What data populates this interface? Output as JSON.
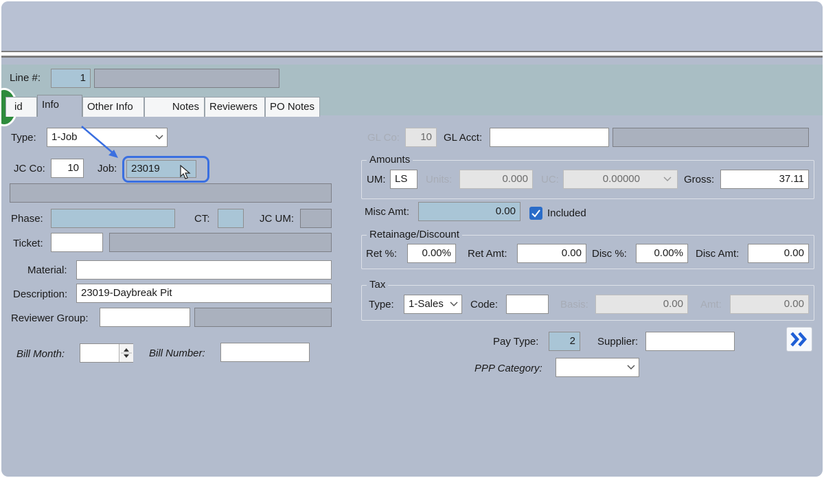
{
  "header": {
    "line_label": "Line #:",
    "line_value": "1",
    "line_desc": ""
  },
  "tabs": [
    {
      "label": "id"
    },
    {
      "label": "Info"
    },
    {
      "label": "Other Info"
    },
    {
      "label": "Notes"
    },
    {
      "label": "Reviewers"
    },
    {
      "label": "PO Notes"
    }
  ],
  "left": {
    "type_label": "Type:",
    "type_value": "1-Job",
    "jcco_label": "JC Co:",
    "jcco_value": "10",
    "job_label": "Job:",
    "job_value": "23019",
    "job_desc": "",
    "phase_label": "Phase:",
    "phase_value": "",
    "ct_label": "CT:",
    "ct_value": "",
    "jcum_label": "JC UM:",
    "jcum_value": "",
    "ticket_label": "Ticket:",
    "ticket_value": "",
    "ticket_desc": "",
    "material_label": "Material:",
    "material_value": "",
    "description_label": "Description:",
    "description_value": "23019-Daybreak Pit",
    "reviewer_label": "Reviewer Group:",
    "reviewer_value": "",
    "reviewer_desc": "",
    "billmonth_label": "Bill Month:",
    "billmonth_value": "",
    "billnumber_label": "Bill Number:",
    "billnumber_value": ""
  },
  "right": {
    "glco_label": "GL Co:",
    "glco_value": "10",
    "glacct_label": "GL Acct:",
    "glacct_value": "",
    "glacct_desc": "",
    "amounts": {
      "title": "Amounts",
      "um_label": "UM:",
      "um_value": "LS",
      "units_label": "Units:",
      "units_value": "0.000",
      "uc_label": "UC:",
      "uc_value": "0.00000",
      "gross_label": "Gross:",
      "gross_value": "37.11"
    },
    "misc_label": "Misc Amt:",
    "misc_value": "0.00",
    "included_label": "Included",
    "retainage": {
      "title": "Retainage/Discount",
      "retpct_label": "Ret %:",
      "retpct_value": "0.00%",
      "retamt_label": "Ret Amt:",
      "retamt_value": "0.00",
      "discpct_label": "Disc %:",
      "discpct_value": "0.00%",
      "discamt_label": "Disc Amt:",
      "discamt_value": "0.00"
    },
    "tax": {
      "title": "Tax",
      "type_label": "Type:",
      "type_value": "1-Sales",
      "code_label": "Code:",
      "code_value": "",
      "basis_label": "Basis:",
      "basis_value": "0.00",
      "amt_label": "Amt:",
      "amt_value": "0.00"
    },
    "paytype_label": "Pay Type:",
    "paytype_value": "2",
    "supplier_label": "Supplier:",
    "supplier_value": "",
    "ppp_label": "PPP Category:",
    "ppp_value": ""
  },
  "icons": {
    "next": "double-chevron-right-icon",
    "dropdown": "chevron-down-icon",
    "cursor": "mouse-pointer-icon",
    "annotation_arrow": "arrow-icon",
    "step_badge": "step-badge-icon"
  },
  "colors": {
    "background": "#b3bccd",
    "header_band": "#a9bec4",
    "highlight_blue": "#3a6fe0",
    "checkbox_blue": "#2a6cc8",
    "badge_green": "#2e8b3d"
  }
}
